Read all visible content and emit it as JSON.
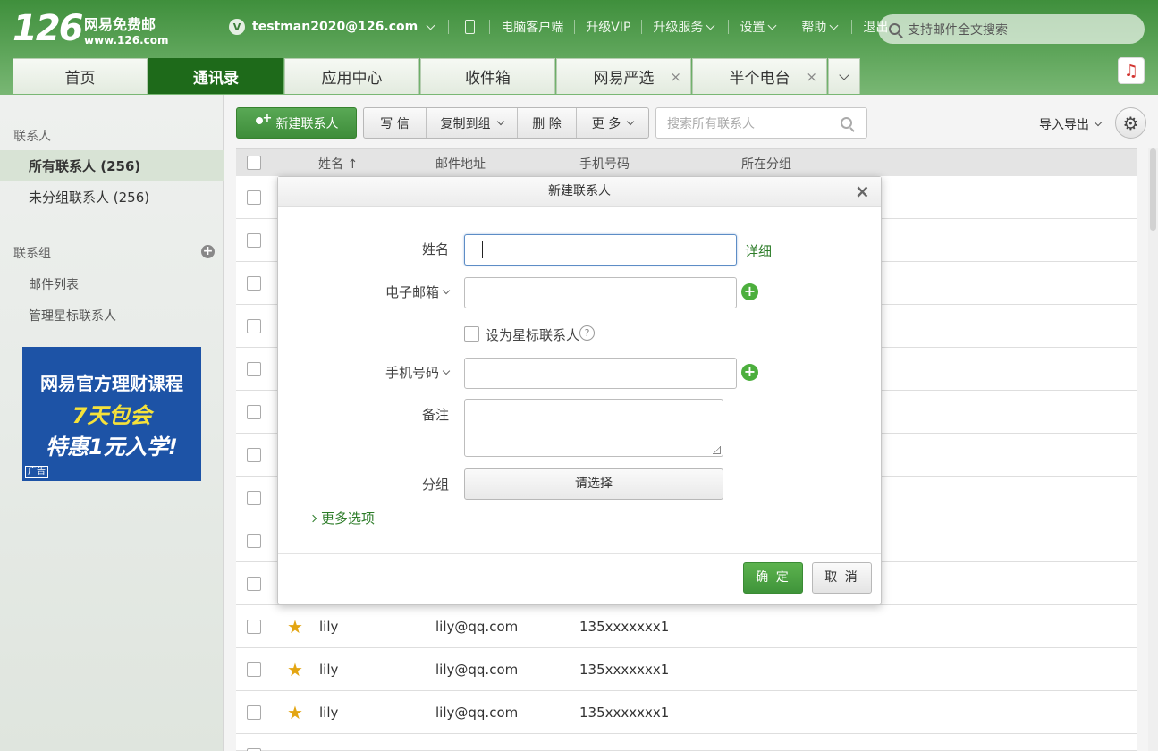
{
  "logo": {
    "number": "126",
    "name": "网易免费邮",
    "url": "www.126.com"
  },
  "topnav": {
    "vip_badge": "V",
    "account": "testman2020@126.com",
    "items": [
      "电脑客户端",
      "升级VIP",
      "升级服务",
      "设置",
      "帮助",
      "退出"
    ]
  },
  "top_search": {
    "placeholder": "支持邮件全文搜索"
  },
  "tabs": [
    {
      "label": "首页",
      "active": false,
      "closable": false
    },
    {
      "label": "通讯录",
      "active": true,
      "closable": false
    },
    {
      "label": "应用中心",
      "active": false,
      "closable": false
    },
    {
      "label": "收件箱",
      "active": false,
      "closable": false
    },
    {
      "label": "网易严选",
      "active": false,
      "closable": true
    },
    {
      "label": "半个电台",
      "active": false,
      "closable": true
    }
  ],
  "sidebar": {
    "contacts_heading": "联系人",
    "all_contacts": "所有联系人 (256)",
    "ungrouped": "未分组联系人 (256)",
    "groups_heading": "联系组",
    "mailing_list": "邮件列表",
    "manage_starred": "管理星标联系人"
  },
  "ad": {
    "line1": "网易官方理财课程",
    "line2": "7天包会",
    "line3": "特惠1元入学!",
    "tag": "广告"
  },
  "toolbar": {
    "new_contact": "新建联系人",
    "write": "写 信",
    "copy_to_group": "复制到组",
    "delete": "删 除",
    "more": "更 多",
    "search_placeholder": "搜索所有联系人",
    "import_export": "导入导出"
  },
  "table": {
    "columns": {
      "name": "姓名 ↑",
      "email": "邮件地址",
      "phone": "手机号码",
      "group": "所在分组"
    },
    "rows": [
      {
        "name": "lily",
        "email": "lily@qq.com",
        "phone": "135xxxxxxx1"
      },
      {
        "name": "lily",
        "email": "lily@qq.com",
        "phone": "135xxxxxxx1"
      },
      {
        "name": "lily",
        "email": "lily@qq.com",
        "phone": "135xxxxxxx1"
      }
    ]
  },
  "modal": {
    "title": "新建联系人",
    "close": "×",
    "name_label": "姓名",
    "detail_link": "详细",
    "email_label": "电子邮箱",
    "star_label": "设为星标联系人",
    "help": "?",
    "phone_label": "手机号码",
    "note_label": "备注",
    "group_label": "分组",
    "group_select": "请选择",
    "more_options": "更多选项",
    "ok": "确 定",
    "cancel": "取 消"
  },
  "colors": {
    "brand_green": "#3e8d3a",
    "active_tab": "#1e6a1a",
    "link_green": "#2e7d2a",
    "star": "#e3a512"
  }
}
